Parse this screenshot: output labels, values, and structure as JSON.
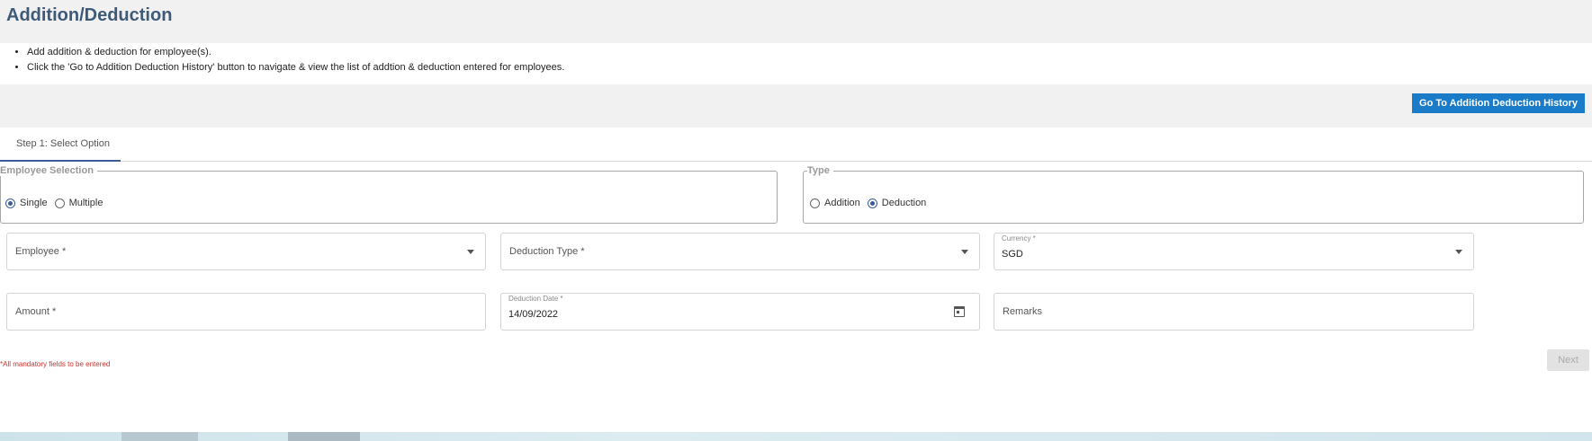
{
  "page": {
    "title": "Addition/Deduction"
  },
  "notes": [
    "Add addition & deduction for employee(s).",
    "Click the 'Go to Addition Deduction History' button to navigate & view the list of addtion & deduction entered for employees."
  ],
  "actions": {
    "history_label": "Go To Addition Deduction History"
  },
  "tabs": {
    "step1": "Step 1: Select Option"
  },
  "employee_selection": {
    "legend": "Employee Selection",
    "options": [
      "Single",
      "Multiple"
    ],
    "selected": "Single"
  },
  "type_selection": {
    "legend": "Type",
    "options": [
      "Addition",
      "Deduction"
    ],
    "selected": "Deduction"
  },
  "fields": {
    "employee": {
      "label": "Employee *",
      "value": ""
    },
    "deduction_type": {
      "label": "Deduction Type *",
      "value": ""
    },
    "currency": {
      "label": "Currency *",
      "value": "SGD"
    },
    "amount": {
      "label": "Amount *",
      "value": ""
    },
    "deduction_date": {
      "label": "Deduction Date *",
      "value": "14/09/2022"
    },
    "remarks": {
      "label": "Remarks",
      "value": ""
    }
  },
  "footer": {
    "mandatory_note": "*All mandatory fields to be entered",
    "next_label": "Next"
  },
  "colors": {
    "title": "#3d5a78",
    "primary_button": "#1a7bc9",
    "accent": "#3d5a9a",
    "error": "#d0312d"
  }
}
